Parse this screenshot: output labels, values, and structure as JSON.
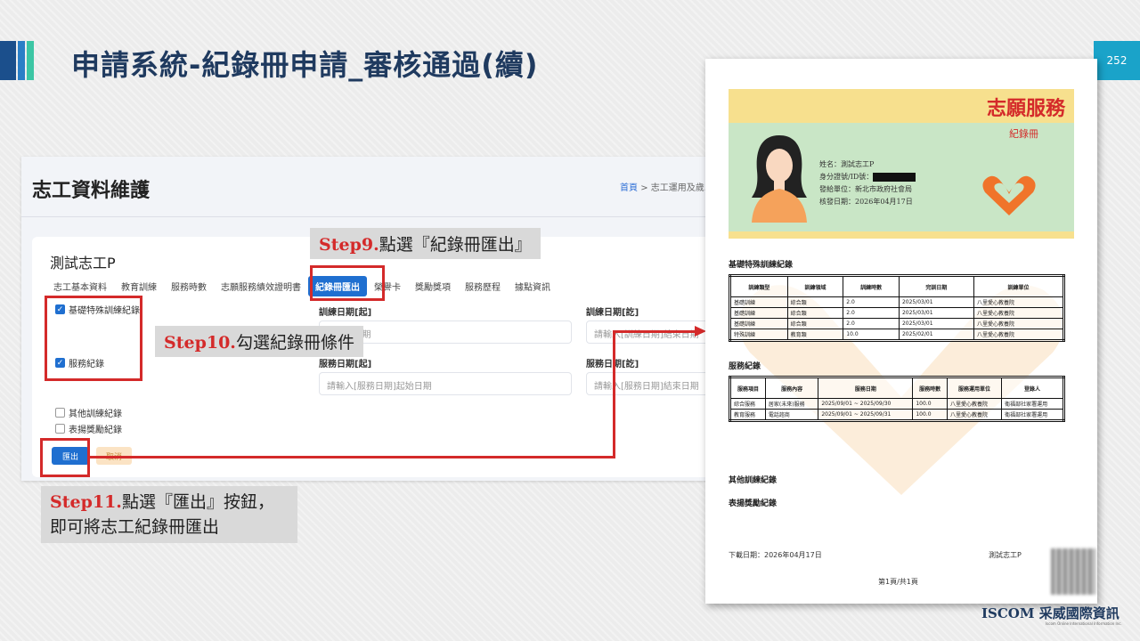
{
  "slide": {
    "title": "申請系統-紀錄冊申請_審核通過(續)",
    "page_number": "252"
  },
  "app": {
    "page_title": "志工資料維護",
    "breadcrumb_home": "首頁",
    "breadcrumb_rest": "> 志工運用及歲...",
    "person_name": "測試志工P",
    "tabs": [
      "志工基本資料",
      "教育訓練",
      "服務時數",
      "志願服務績效證明書",
      "紀錄冊匯出",
      "榮譽卡",
      "獎勵獎項",
      "服務歷程",
      "據點資訊"
    ],
    "checkboxes": {
      "basic_training": "基礎特殊訓練紀錄",
      "service": "服務紀錄",
      "other_training": "其他訓練紀錄",
      "awards": "表揚獎勵紀錄"
    },
    "fields": {
      "train_start_label": "訓練日期[起]",
      "train_start_placeholder": "...起始日期",
      "train_end_label": "訓練日期[訖]",
      "train_end_placeholder": "請輸入[訓練日期]結束日期",
      "service_start_label": "服務日期[起]",
      "service_start_placeholder": "請輸入[服務日期]起始日期",
      "service_end_label": "服務日期[訖]",
      "service_end_placeholder": "請輸入[服務日期]結束日期"
    },
    "export_button": "匯出",
    "cancel_button": "取消"
  },
  "callouts": {
    "step9_num": "Step9.",
    "step9_text": "點選『紀錄冊匯出』",
    "step10_num": "Step10.",
    "step10_text": "勾選紀錄冊條件",
    "step11_num": "Step11.",
    "step11_text_1": "點選『匯出』按鈕，",
    "step11_text_2": "即可將志工紀錄冊匯出"
  },
  "document": {
    "title": "志願服務",
    "subtitle": "紀錄冊",
    "name_line": "姓名：測試志工P",
    "id_line": "身分證號/ID號：",
    "issuer_line": "發給單位：新北市政府社會局",
    "issue_date_line": "核發日期：2026年04月17日",
    "training_section": "基礎特殊訓練紀錄",
    "training_headers": [
      "訓練類型",
      "訓練領域",
      "訓練時數",
      "完訓日期",
      "訓練單位"
    ],
    "training_rows": [
      [
        "基礎訓練",
        "綜合類",
        "2.0",
        "2025/03/01",
        "八里愛心教養院"
      ],
      [
        "基礎訓練",
        "綜合類",
        "2.0",
        "2025/03/01",
        "八里愛心教養院"
      ],
      [
        "基礎訓練",
        "綜合類",
        "2.0",
        "2025/03/01",
        "八里愛心教養院"
      ],
      [
        "特殊訓練",
        "教育類",
        "10.0",
        "2025/02/01",
        "八里愛心教養院"
      ]
    ],
    "service_section": "服務紀錄",
    "service_headers": [
      "服務項目",
      "服務內容",
      "服務日期",
      "服務時數",
      "服務運用單位",
      "登錄人"
    ],
    "service_rows": [
      [
        "綜合服務",
        "居家(未來)服務",
        "2025/09/01 ~ 2025/09/30",
        "100.0",
        "八里愛心教養院",
        "衛福部社家署運用"
      ],
      [
        "教育服務",
        "電話諮商",
        "2025/09/01 ~ 2025/09/31",
        "100.0",
        "八里愛心教養院",
        "衛福部社家署運用"
      ]
    ],
    "other_training_section": "其他訓練紀錄",
    "awards_section": "表揚獎勵紀錄",
    "download_date": "下載日期：2026年04月17日",
    "footer_name": "測試志工P",
    "page_info": "第1頁/共1頁"
  },
  "logo": {
    "en": "ISCOM",
    "cn": "采威國際資訊",
    "sub": "Iscom Online International Information Inc."
  },
  "colors": {
    "highlight": "#d42a2a",
    "primary_button": "#1f6fd0",
    "title": "#1f3a5f",
    "page_badge": "#1aa3c9"
  }
}
